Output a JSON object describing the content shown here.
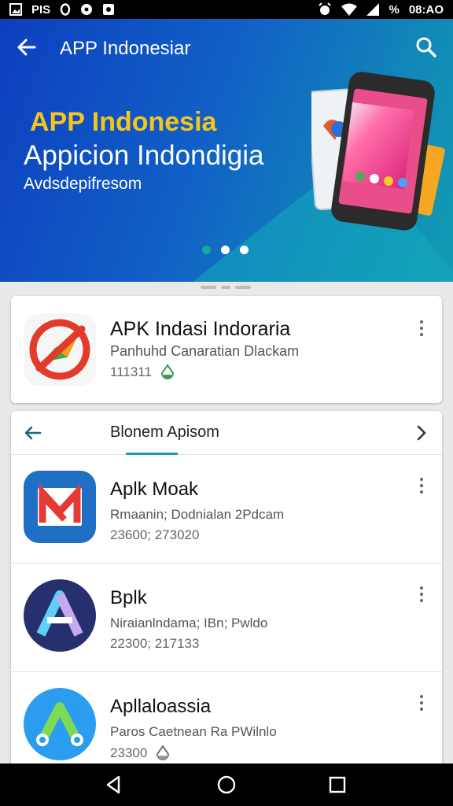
{
  "status_bar": {
    "left_text": "PIS",
    "time": "08:AO",
    "battery_text": "%",
    "icons": [
      "image-icon",
      "circle-icon",
      "chat-icon",
      "play-icon",
      "alarm-icon",
      "wifi-icon",
      "signal-icon"
    ]
  },
  "header": {
    "title": "APP Indonesiar",
    "back_icon": "arrow-left-icon",
    "search_icon": "search-icon"
  },
  "banner": {
    "headline": "APP Indonesia",
    "subheadline": "Appicion  Indondigia",
    "tagline": "Avdsdepifresom",
    "slide_count": 3,
    "active_slide": 0,
    "colors": {
      "headline": "#f5c41f",
      "gradient_start": "#0d3fbf",
      "gradient_end": "#129cb3"
    }
  },
  "featured_app": {
    "name": "APK Indasi Indoraria",
    "description": "Panhuhd Canaratian Dlackam",
    "meta": "111311",
    "badge_icon": "drop-badge-icon",
    "icon": "compass-app-icon"
  },
  "list": {
    "tab_label": "Blonem Apisom",
    "back_icon": "arrow-left-icon",
    "next_icon": "chevron-right-icon",
    "accent": "#1a9ab0",
    "items": [
      {
        "name": "Aplk Moak",
        "description": "Rmaanin; Dodnialan 2Pdcam",
        "meta": "23600; 273020",
        "icon": "m-logo-app-icon"
      },
      {
        "name": "Bplk",
        "description": "Niraianlndama; IBn; Pwldo",
        "meta": "22300; 217133",
        "icon": "a-logo-app-icon"
      },
      {
        "name": "Apllaloassia",
        "description": "Paros Caetnean Ra PWilnlo",
        "meta": "23300",
        "icon": "a-arrows-app-icon"
      }
    ]
  },
  "nav_bar": {
    "back_icon": "triangle-back-icon",
    "home_icon": "circle-home-icon",
    "recents_icon": "square-recents-icon"
  }
}
